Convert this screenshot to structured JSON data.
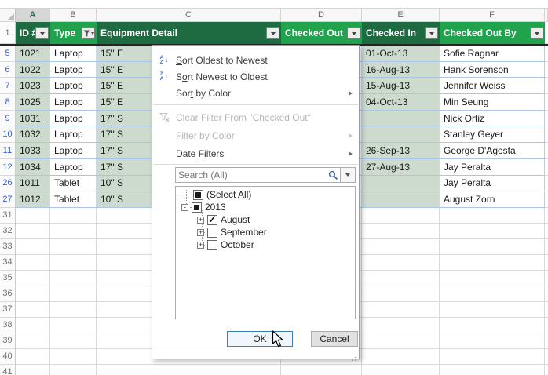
{
  "sheet": {
    "column_letters": [
      "A",
      "B",
      "C",
      "D",
      "E",
      "F"
    ],
    "header_row_number": "1",
    "table_headers": [
      {
        "label": "ID #"
      },
      {
        "label": "Type"
      },
      {
        "label": "Equipment Detail"
      },
      {
        "label": "Checked Out"
      },
      {
        "label": "Checked In"
      },
      {
        "label": "Checked Out By"
      }
    ],
    "rows": [
      {
        "n": "5",
        "id": "1021",
        "type": "Laptop",
        "detail": "15\" E",
        "checked_out": "",
        "checked_in": "01-Oct-13",
        "checked_out_by": "Sofie Ragnar"
      },
      {
        "n": "6",
        "id": "1022",
        "type": "Laptop",
        "detail": "15\" E",
        "checked_out": "",
        "checked_in": "16-Aug-13",
        "checked_out_by": "Hank Sorenson"
      },
      {
        "n": "7",
        "id": "1023",
        "type": "Laptop",
        "detail": "15\" E",
        "checked_out": "",
        "checked_in": "15-Aug-13",
        "checked_out_by": "Jennifer Weiss"
      },
      {
        "n": "8",
        "id": "1025",
        "type": "Laptop",
        "detail": "15\" E",
        "checked_out": "",
        "checked_in": "04-Oct-13",
        "checked_out_by": "Min Seung"
      },
      {
        "n": "9",
        "id": "1031",
        "type": "Laptop",
        "detail": "17\" S",
        "checked_out": "",
        "checked_in": "",
        "checked_out_by": "Nick Ortiz"
      },
      {
        "n": "10",
        "id": "1032",
        "type": "Laptop",
        "detail": "17\" S",
        "checked_out": "",
        "checked_in": "",
        "checked_out_by": "Stanley Geyer"
      },
      {
        "n": "11",
        "id": "1033",
        "type": "Laptop",
        "detail": "17\" S",
        "checked_out": "",
        "checked_in": "26-Sep-13",
        "checked_out_by": "George D'Agosta"
      },
      {
        "n": "12",
        "id": "1034",
        "type": "Laptop",
        "detail": "17\" S",
        "checked_out": "",
        "checked_in": "27-Aug-13",
        "checked_out_by": "Jay Peralta"
      },
      {
        "n": "26",
        "id": "1011",
        "type": "Tablet",
        "detail": "10\" S",
        "checked_out": "",
        "checked_in": "",
        "checked_out_by": "Jay Peralta"
      },
      {
        "n": "27",
        "id": "1012",
        "type": "Tablet",
        "detail": "10\" S",
        "checked_out": "",
        "checked_in": "",
        "checked_out_by": "August Zorn"
      }
    ],
    "empty_row_numbers": [
      "31",
      "32",
      "33",
      "34",
      "35",
      "36",
      "37",
      "38",
      "39",
      "40",
      "41"
    ]
  },
  "filter_menu": {
    "sort_oldest": {
      "pre": "",
      "key": "S",
      "post": "ort Oldest to Newest"
    },
    "sort_newest": {
      "pre": "S",
      "key": "o",
      "post": "rt Newest to Oldest"
    },
    "sort_by_color": {
      "pre": "Sor",
      "key": "t",
      "post": " by Color"
    },
    "clear_filter": {
      "pre": "",
      "key": "C",
      "post": "lear Filter From \"Checked Out\""
    },
    "filter_by_color": {
      "pre": "F",
      "key": "i",
      "post": "lter by Color"
    },
    "date_filters": {
      "pre": "Date ",
      "key": "F",
      "post": "ilters"
    },
    "search_placeholder": "Search (All)",
    "tree": {
      "items": [
        {
          "label": "(Select All)",
          "state": "mixed"
        },
        {
          "label": "2013",
          "state": "mixed",
          "expander": "-"
        },
        {
          "label": "August",
          "state": "checked",
          "expander": "+"
        },
        {
          "label": "September",
          "state": "unchecked",
          "expander": "+"
        },
        {
          "label": "October",
          "state": "unchecked",
          "expander": "+"
        }
      ],
      "check_glyph": "✓"
    },
    "ok_label": "OK",
    "cancel_label": "Cancel"
  },
  "icons": {
    "sort_az": {
      "top": "A",
      "bottom": "Z",
      "arrow": "↓"
    },
    "sort_za": {
      "top": "Z",
      "bottom": "A",
      "arrow": "↓"
    }
  },
  "colors": {
    "header_dark_green": "#1E6B41",
    "header_bright_green": "#21A24D",
    "banded_cell_green": "#CDDBCF",
    "table_row_border_blue": "#A9C6E8",
    "filtered_row_number_blue": "#3A5DC9",
    "ok_button_border": "#3C7FB1"
  }
}
